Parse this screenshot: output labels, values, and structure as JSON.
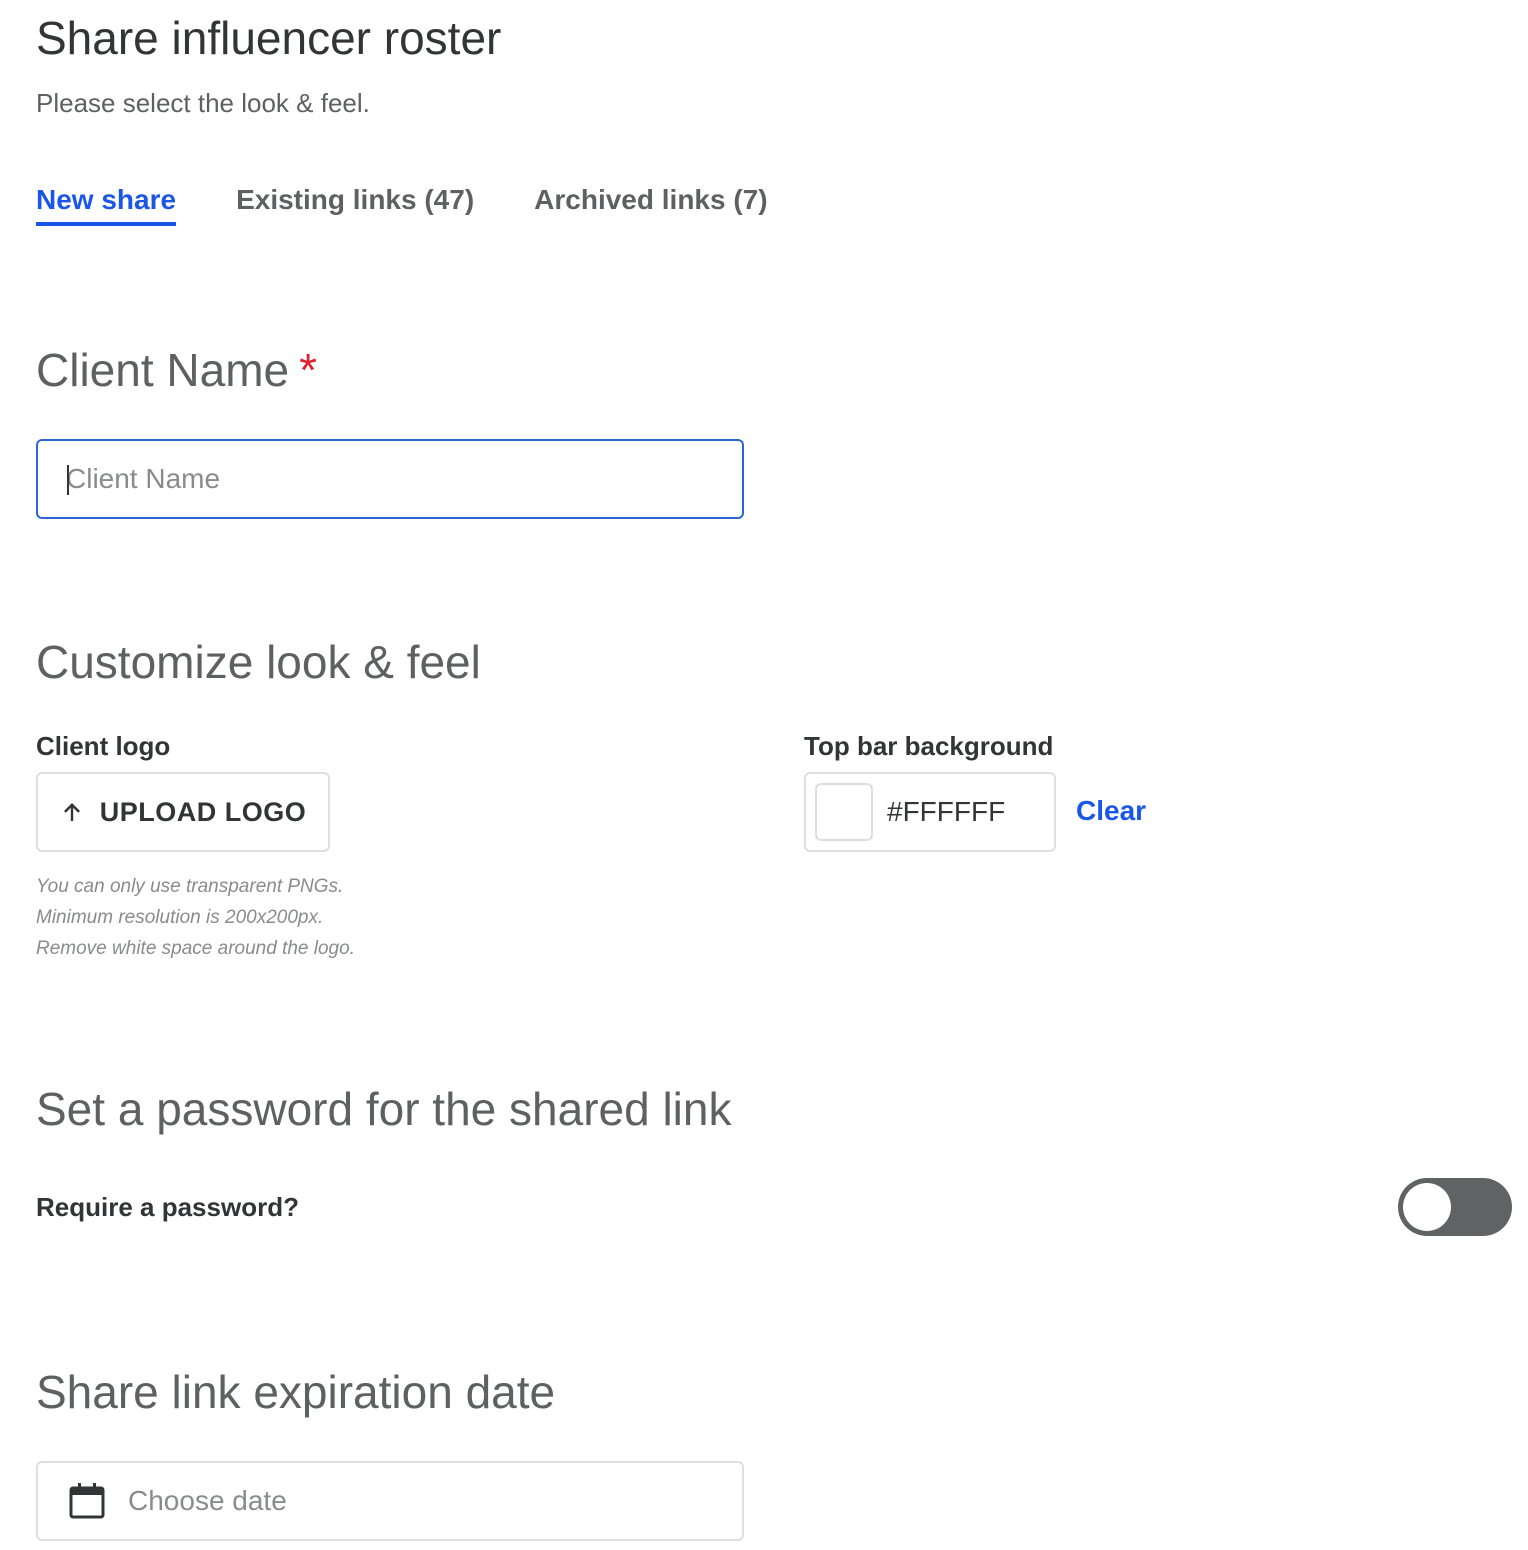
{
  "header": {
    "title": "Share influencer roster",
    "subtitle": "Please select the look & feel."
  },
  "tabs": [
    {
      "label": "New share",
      "active": true
    },
    {
      "label": "Existing links (47)",
      "active": false
    },
    {
      "label": "Archived links (7)",
      "active": false
    }
  ],
  "client_name": {
    "heading": "Client Name",
    "required_mark": "*",
    "placeholder": "Client Name",
    "value": ""
  },
  "customize": {
    "heading": "Customize look & feel",
    "logo_label": "Client logo",
    "upload_button_label": "UPLOAD LOGO",
    "upload_icon": "arrow-up-icon",
    "hints": [
      "You can only use transparent PNGs.",
      "Minimum resolution is 200x200px.",
      "Remove white space around the logo."
    ],
    "top_bar_label": "Top bar background",
    "top_bar_color": "#FFFFFF",
    "clear_label": "Clear"
  },
  "password": {
    "heading": "Set a password for the shared link",
    "require_label": "Require a password?",
    "enabled": false
  },
  "expiration": {
    "heading": "Share link expiration date",
    "placeholder": "Choose date",
    "icon": "calendar-icon"
  },
  "colors": {
    "accent": "#1a56e8",
    "required": "#e1222e",
    "toggle_off": "#616263"
  }
}
